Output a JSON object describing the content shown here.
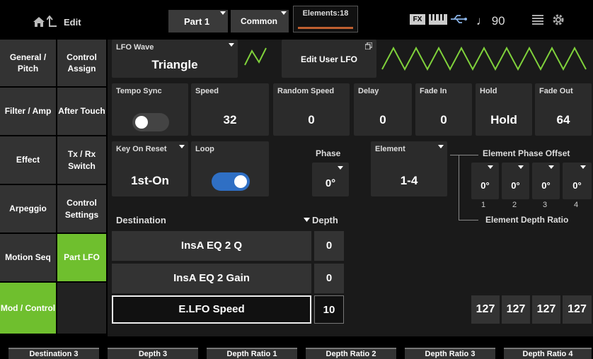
{
  "header": {
    "edit_label": "Edit",
    "part_label": "Part 1",
    "common_label": "Common",
    "elements_label": "Elements:18",
    "fx_label": "FX",
    "tempo_label": "♩ 90"
  },
  "nav_left": [
    "General / Pitch",
    "Filter / Amp",
    "Effect",
    "Arpeggio",
    "Motion Seq",
    "Mod / Control"
  ],
  "nav_right": [
    "Control Assign",
    "After Touch",
    "Tx / Rx Switch",
    "Control Settings",
    "Part LFO",
    ""
  ],
  "lfo": {
    "wave_label": "LFO Wave",
    "wave_value": "Triangle",
    "edit_user_label": "Edit User LFO",
    "tempo_sync_label": "Tempo Sync",
    "speed_label": "Speed",
    "speed_value": "32",
    "random_speed_label": "Random Speed",
    "random_speed_value": "0",
    "delay_label": "Delay",
    "delay_value": "0",
    "fade_in_label": "Fade In",
    "fade_in_value": "0",
    "hold_label": "Hold",
    "hold_value": "Hold",
    "fade_out_label": "Fade Out",
    "fade_out_value": "64",
    "key_on_reset_label": "Key On Reset",
    "key_on_reset_value": "1st-On",
    "loop_label": "Loop",
    "phase_label": "Phase",
    "phase_value": "0°",
    "element_label": "Element",
    "element_value": "1-4",
    "element_phase_offset_label": "Element Phase Offset",
    "element_phase_offsets": [
      "0°",
      "0°",
      "0°",
      "0°"
    ],
    "element_numbers": [
      "1",
      "2",
      "3",
      "4"
    ],
    "element_depth_ratio_label": "Element Depth Ratio",
    "element_depth_ratios": [
      "127",
      "127",
      "127",
      "127"
    ]
  },
  "destination": {
    "header_label": "Destination",
    "depth_header_label": "Depth",
    "rows": [
      {
        "name": "InsA EQ 2 Q",
        "depth": "0"
      },
      {
        "name": "InsA EQ 2 Gain",
        "depth": "0"
      },
      {
        "name": "E.LFO Speed",
        "depth": "10"
      }
    ]
  },
  "function_keys": [
    "Destination 3",
    "Depth 3",
    "Depth Ratio 1",
    "Depth Ratio 2",
    "Depth Ratio 3",
    "Depth Ratio 4"
  ],
  "toggles": {
    "tempo_sync_on": false,
    "loop_on": true
  },
  "colors": {
    "accent_green": "#7fd13b",
    "toggle_blue": "#2f6fc4"
  }
}
